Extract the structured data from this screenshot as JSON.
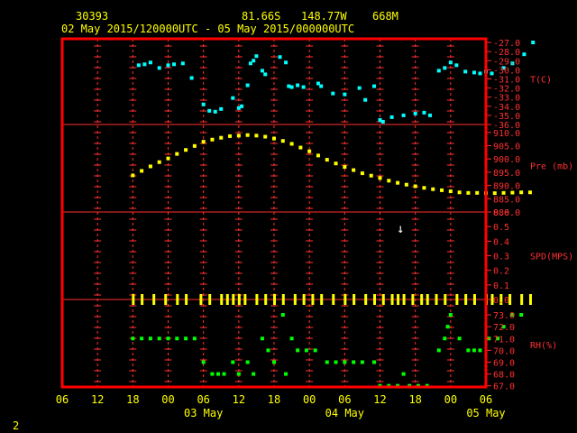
{
  "header": {
    "station_id": "30393",
    "latitude": "81.66S",
    "longitude": "148.77W",
    "elevation": "668M",
    "time_range": "02 May 2015/120000UTC - 05 May 2015/000000UTC"
  },
  "footer": {
    "page_number": "2"
  },
  "colors": {
    "frame": "#ff0000",
    "grid": "#ff3030",
    "text": "#ffff00",
    "axis_labels": "#ff3030",
    "temperature": "#00ffff",
    "pressure": "#ffff00",
    "wind": "#ffff00",
    "humidity": "#00ff00",
    "background": "#000000"
  },
  "chart_data": {
    "type": "scatter",
    "x_axis": {
      "unit": "hours",
      "range": [
        -12,
        60
      ],
      "tick_labels": [
        "06",
        "12",
        "18",
        "00",
        "06",
        "12",
        "18",
        "00",
        "06",
        "12",
        "18",
        "00",
        "06"
      ],
      "date_labels": [
        {
          "hour": 12,
          "label": "03 May"
        },
        {
          "hour": 36,
          "label": "04 May"
        },
        {
          "hour": 60,
          "label": "05 May"
        }
      ]
    },
    "panels": [
      {
        "name": "temperature",
        "label": "T(C)",
        "color": "#00ffff",
        "ylim": [
          -36,
          -26.6
        ],
        "ticks": [
          -27,
          -28,
          -29,
          -30,
          -31,
          -32,
          -33,
          -34,
          -35,
          -36
        ],
        "tick_labels": [
          "-27.0",
          "-28.0",
          "-29.0",
          "-30.0",
          "-31.0",
          "-32.0",
          "-33.0",
          "-34.0",
          "-35.0",
          "-36.0"
        ],
        "label_at": -31,
        "points": [
          [
            1,
            -29.5
          ],
          [
            2,
            -29.4
          ],
          [
            3,
            -29.2
          ],
          [
            4.5,
            -29.8
          ],
          [
            6,
            -29.5
          ],
          [
            7,
            -29.4
          ],
          [
            8.5,
            -29.3
          ],
          [
            10,
            -30.9
          ],
          [
            12,
            -33.8
          ],
          [
            13,
            -34.5
          ],
          [
            14,
            -34.6
          ],
          [
            15,
            -34.3
          ],
          [
            17,
            -33.1
          ],
          [
            18,
            -34.2
          ],
          [
            18.5,
            -34
          ],
          [
            19.5,
            -31.7
          ],
          [
            20,
            -29.3
          ],
          [
            20.5,
            -29
          ],
          [
            21,
            -28.5
          ],
          [
            22,
            -30.1
          ],
          [
            22.5,
            -30.5
          ],
          [
            25,
            -28.6
          ],
          [
            26,
            -29.2
          ],
          [
            26.5,
            -31.8
          ],
          [
            27,
            -31.9
          ],
          [
            28,
            -31.7
          ],
          [
            29,
            -31.9
          ],
          [
            31.5,
            -31.5
          ],
          [
            32,
            -31.8
          ],
          [
            34,
            -32.6
          ],
          [
            36,
            -32.7
          ],
          [
            38.5,
            -32
          ],
          [
            39.5,
            -33.3
          ],
          [
            41,
            -31.8
          ],
          [
            42,
            -35.5
          ],
          [
            42.5,
            -35.7
          ],
          [
            44,
            -35.2
          ],
          [
            46,
            -35
          ],
          [
            48,
            -34.8
          ],
          [
            49.5,
            -34.7
          ],
          [
            50.5,
            -35
          ],
          [
            52,
            -30.1
          ],
          [
            53,
            -29.8
          ],
          [
            54,
            -29.2
          ],
          [
            55,
            -29.5
          ],
          [
            56.5,
            -30.2
          ],
          [
            58,
            -30.3
          ],
          [
            59,
            -30.4
          ],
          [
            60,
            -30.2
          ],
          [
            61,
            -30.4
          ],
          [
            63,
            -29.8
          ],
          [
            64.5,
            -29.3
          ],
          [
            66.5,
            -28.3
          ],
          [
            68,
            -27
          ]
        ]
      },
      {
        "name": "pressure",
        "label": "Pre (mb)",
        "color": "#ffff00",
        "ylim": [
          880,
          913
        ],
        "ticks": [
          910,
          905,
          900,
          895,
          890,
          885,
          880
        ],
        "tick_labels": [
          "910.0",
          "905.0",
          "900.0",
          "895.0",
          "890.0",
          "885.0",
          "880.0"
        ],
        "label_at": 897.5,
        "points": [
          [
            0,
            893.8
          ],
          [
            1.5,
            895.5
          ],
          [
            3,
            897.2
          ],
          [
            4.5,
            898.8
          ],
          [
            6,
            900.2
          ],
          [
            7.5,
            901.9
          ],
          [
            9,
            903.4
          ],
          [
            10.5,
            904.9
          ],
          [
            12,
            906.5
          ],
          [
            13.5,
            907.3
          ],
          [
            15,
            908
          ],
          [
            16.5,
            908.6
          ],
          [
            18,
            908.8
          ],
          [
            19.5,
            909
          ],
          [
            21,
            908.8
          ],
          [
            22.5,
            908.4
          ],
          [
            24,
            907.7
          ],
          [
            25.5,
            906.8
          ],
          [
            27,
            905.7
          ],
          [
            28.5,
            904.3
          ],
          [
            30,
            902.9
          ],
          [
            31.5,
            901.3
          ],
          [
            33,
            899.7
          ],
          [
            34.5,
            898.3
          ],
          [
            36,
            897
          ],
          [
            37.5,
            895.8
          ],
          [
            39,
            894.6
          ],
          [
            40.5,
            893.7
          ],
          [
            42,
            892.8
          ],
          [
            43.5,
            891.8
          ],
          [
            45,
            891
          ],
          [
            46.5,
            890.3
          ],
          [
            48,
            889.7
          ],
          [
            49.5,
            889.1
          ],
          [
            51,
            888.6
          ],
          [
            52.5,
            888.2
          ],
          [
            54,
            887.8
          ],
          [
            55.5,
            887.4
          ],
          [
            57,
            887.2
          ],
          [
            58.5,
            887.2
          ],
          [
            60,
            887.1
          ],
          [
            61.5,
            887.1
          ],
          [
            63,
            887.2
          ],
          [
            64.5,
            887.3
          ],
          [
            66,
            887.4
          ],
          [
            67.5,
            887.4
          ]
        ]
      },
      {
        "name": "wind",
        "label": "SPD(MPS)",
        "color": "#ffff00",
        "ylim": [
          0,
          0.6
        ],
        "ticks": [
          0.6,
          0.5,
          0.4,
          0.3,
          0.2,
          0.1,
          0
        ],
        "tick_labels": [
          "0.6",
          "0.5",
          "0.4",
          "0.3",
          "0.2",
          "0.1",
          "0.0"
        ],
        "label_at": 0.3,
        "arrow": {
          "x": 45.5,
          "y": 0.49,
          "glyph": "↓"
        },
        "barbs_at_zero": [
          0,
          1.5,
          3.5,
          5.5,
          7.5,
          9,
          11.5,
          13,
          15,
          16,
          17,
          18,
          19,
          21,
          22.5,
          24,
          25.5,
          27.5,
          29,
          30.5,
          32,
          34,
          36,
          37.5,
          39.5,
          41,
          42.5,
          44,
          45,
          46,
          47.5,
          49,
          50,
          51.5,
          53,
          55,
          56.5,
          58,
          60,
          61,
          62.5,
          64,
          66,
          67.5
        ]
      },
      {
        "name": "humidity",
        "label": "RH(%)",
        "color": "#00ff00",
        "ylim": [
          66.9,
          74.3
        ],
        "ticks": [
          73,
          72,
          71,
          70,
          69,
          68,
          67
        ],
        "tick_labels": [
          "73.0",
          "72.0",
          "71.0",
          "70.0",
          "69.0",
          "68.0",
          "67.0"
        ],
        "label_at": 70.5,
        "points": [
          [
            0,
            71
          ],
          [
            1.5,
            71
          ],
          [
            3,
            71
          ],
          [
            4.5,
            71
          ],
          [
            6,
            71
          ],
          [
            7.5,
            71
          ],
          [
            9,
            71
          ],
          [
            10.5,
            71
          ],
          [
            12,
            69
          ],
          [
            13.5,
            68
          ],
          [
            14.5,
            68
          ],
          [
            15.5,
            68
          ],
          [
            17,
            69
          ],
          [
            18,
            68
          ],
          [
            19.5,
            69
          ],
          [
            20.5,
            68
          ],
          [
            22,
            71
          ],
          [
            23,
            70
          ],
          [
            24,
            69
          ],
          [
            25.5,
            73
          ],
          [
            26,
            68
          ],
          [
            27,
            71
          ],
          [
            28,
            70
          ],
          [
            29.5,
            70
          ],
          [
            31,
            70
          ],
          [
            33,
            69
          ],
          [
            34.5,
            69
          ],
          [
            36,
            69
          ],
          [
            37.5,
            69
          ],
          [
            39,
            69
          ],
          [
            41,
            69
          ],
          [
            42,
            67
          ],
          [
            43.5,
            67
          ],
          [
            45,
            67
          ],
          [
            46,
            68
          ],
          [
            47,
            67
          ],
          [
            48.5,
            67
          ],
          [
            50,
            67
          ],
          [
            52,
            70
          ],
          [
            53,
            71
          ],
          [
            53.5,
            72
          ],
          [
            54,
            73
          ],
          [
            55.5,
            71
          ],
          [
            57,
            70
          ],
          [
            58,
            70
          ],
          [
            59,
            70
          ],
          [
            60.5,
            71
          ],
          [
            62,
            71
          ],
          [
            63,
            72
          ],
          [
            64.5,
            73
          ],
          [
            66,
            73
          ]
        ]
      }
    ]
  }
}
